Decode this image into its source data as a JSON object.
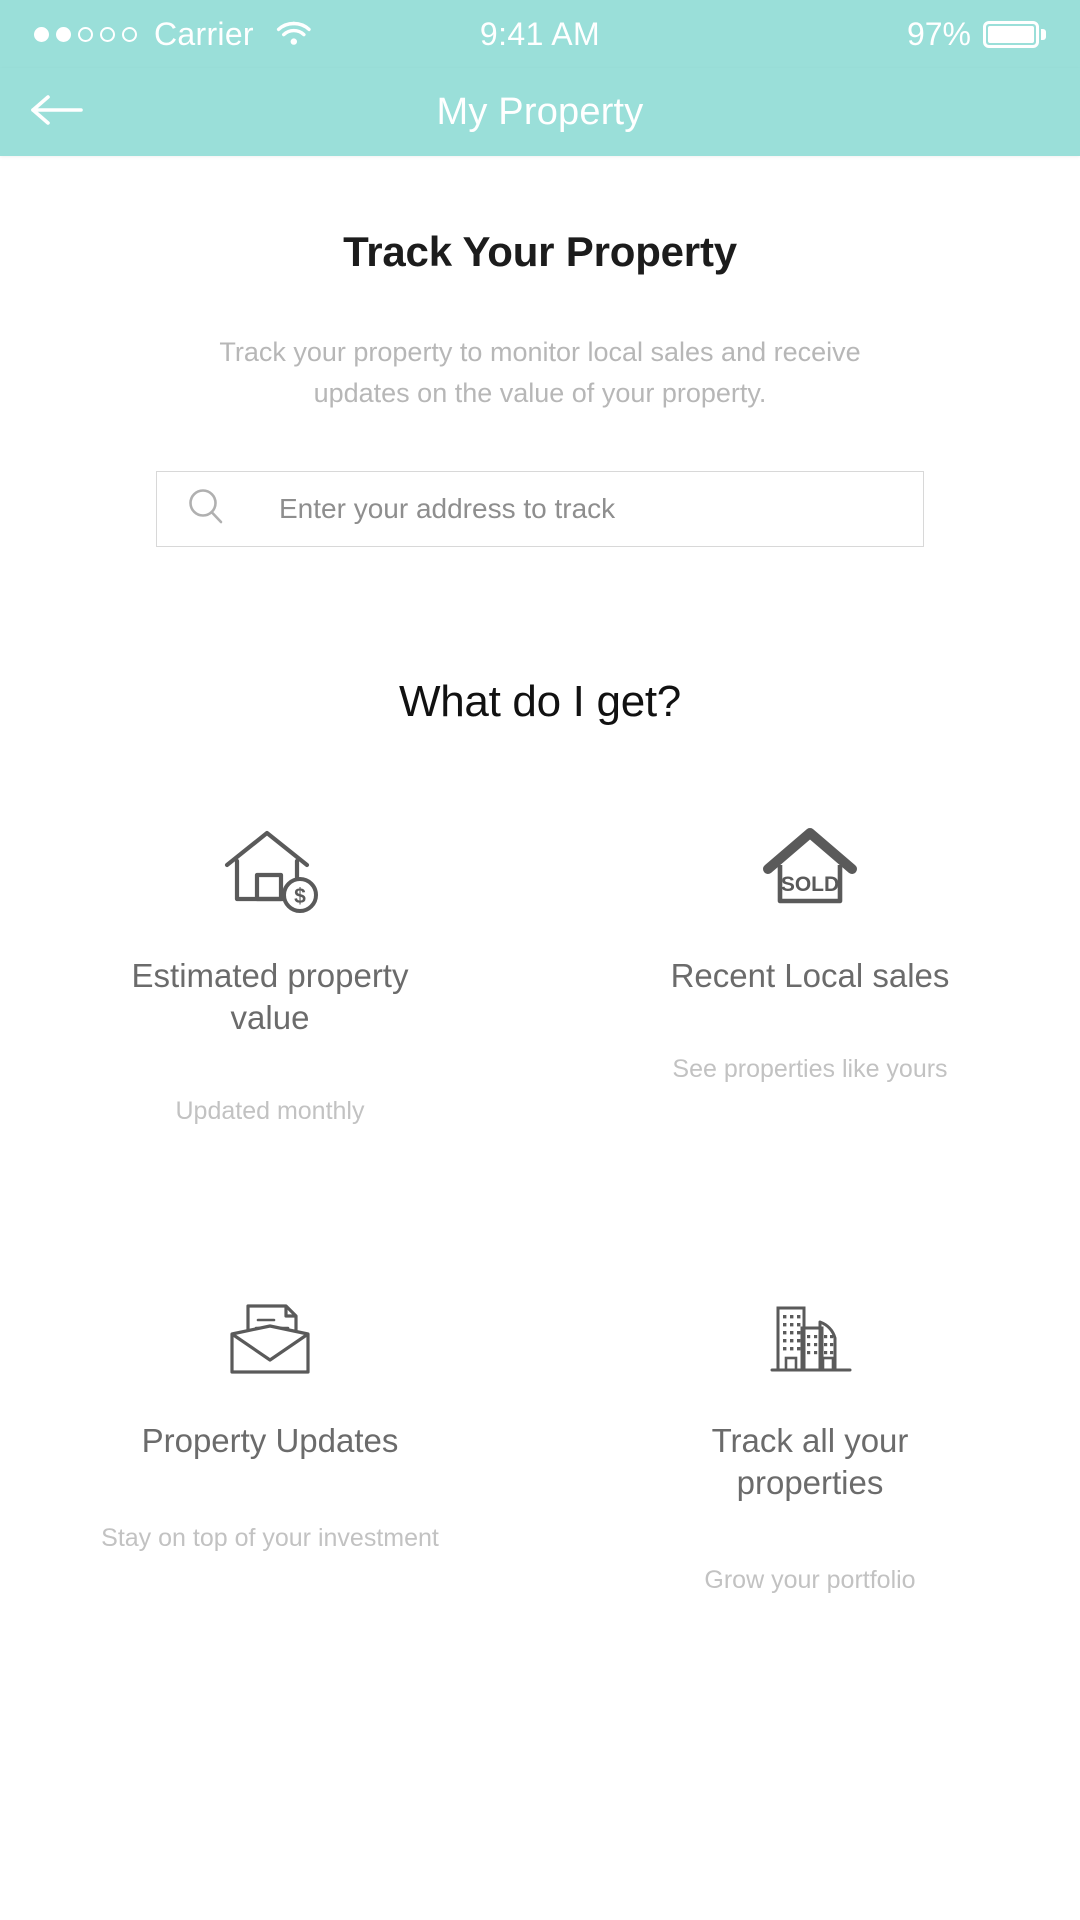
{
  "theme": {
    "accent": "#9adfd9",
    "title_color": "#1c1c1c",
    "muted_color": "#b7b7b7",
    "body_bg": "#ffffff"
  },
  "status_bar": {
    "carrier": "Carrier",
    "signal_dots_total": 5,
    "signal_dots_filled": 2,
    "wifi_icon": "wifi-icon",
    "time": "9:41 AM",
    "battery_percent": "97%",
    "battery_icon": "battery-icon"
  },
  "nav": {
    "back_icon": "arrow-left-icon",
    "title": "My Property"
  },
  "hero": {
    "title": "Track Your Property",
    "subtitle": "Track your property to monitor local sales and receive updates on the value of your property."
  },
  "search": {
    "icon": "search-icon",
    "placeholder": "Enter your address to track",
    "value": ""
  },
  "features": {
    "heading": "What do I get?",
    "items": [
      {
        "icon": "house-dollar-icon",
        "title": "Estimated property value",
        "subtitle": "Updated monthly"
      },
      {
        "icon": "house-sold-icon",
        "icon_label": "SOLD",
        "title": "Recent Local sales",
        "subtitle": "See properties like yours"
      },
      {
        "icon": "envelope-document-icon",
        "title": "Property Updates",
        "subtitle": "Stay on top of your investment"
      },
      {
        "icon": "buildings-icon",
        "title": "Track all your properties",
        "subtitle": "Grow your portfolio"
      }
    ]
  }
}
